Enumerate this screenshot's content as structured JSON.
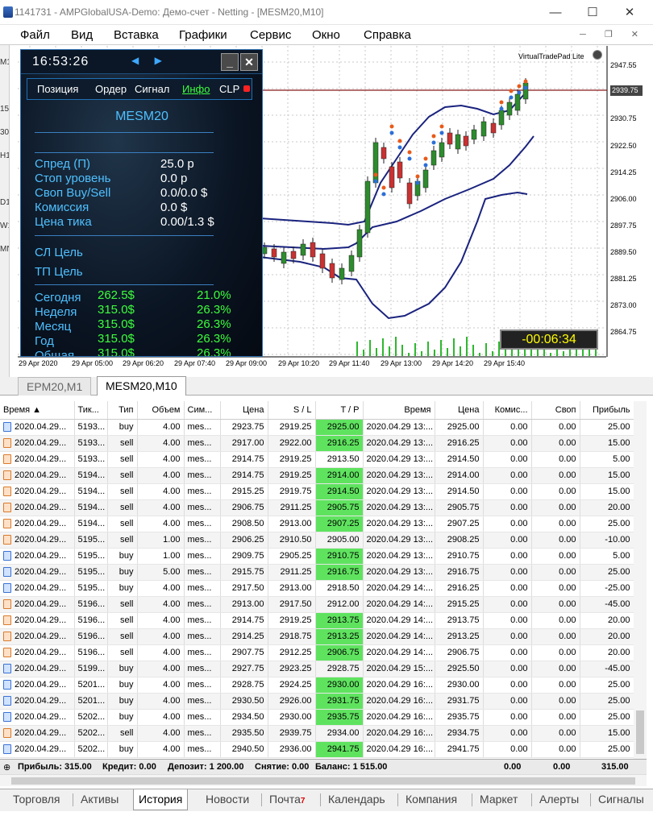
{
  "window": {
    "title": "1141731 - AMPGlobalUSA-Demo: Демо-счет - Netting - [MESM20,M10]",
    "min": "—",
    "max": "☐",
    "close": "✕"
  },
  "menu": [
    "Файл",
    "Вид",
    "Вставка",
    "Графики",
    "Сервис",
    "Окно",
    "Справка"
  ],
  "left_toolbar": [
    "M1",
    "15",
    "30",
    "H1",
    "D1",
    "W1",
    "MN"
  ],
  "chart": {
    "vtp_label": "VirtualTradePad  Lite",
    "timer": "-00:06:34",
    "current_price": "2939.75",
    "y_ticks": [
      "2947.55",
      "2939.75",
      "2930.75",
      "2922.50",
      "2914.25",
      "2906.00",
      "2897.75",
      "2889.50",
      "2881.25",
      "2873.00",
      "2864.75"
    ],
    "x_ticks": [
      "29 Apr 2020",
      "29 Apr 05:00",
      "29 Apr 06:20",
      "29 Apr 07:40",
      "29 Apr 09:00",
      "29 Apr 10:20",
      "29 Apr 11:40",
      "29 Apr 13:00",
      "29 Apr 14:20",
      "29 Apr 15:40"
    ]
  },
  "panel": {
    "time": "16:53:26",
    "arrows": "◀ ▶",
    "min_btn": "_",
    "close_btn": "✕",
    "tabs": [
      "Позиция",
      "Ордер",
      "Сигнал",
      "Инфо",
      "CLP"
    ],
    "symbol": "MESM20",
    "info": [
      {
        "label": "Спред (П)",
        "value": "25.0 p"
      },
      {
        "label": "Стоп уровень",
        "value": "0.0 p"
      },
      {
        "label": "Своп Buy/Sell",
        "value": "0.0/0.0 $"
      },
      {
        "label": "Комиссия",
        "value": "0.0 $"
      },
      {
        "label": "Цена тика",
        "value": "0.00/1.3 $"
      }
    ],
    "sl_target": "СЛ Цель",
    "tp_target": "ТП Цель",
    "stats": [
      {
        "label": "Сегодня",
        "amount": "262.5$",
        "pct": "21.0%"
      },
      {
        "label": "Неделя",
        "amount": "315.0$",
        "pct": "26.3%"
      },
      {
        "label": "Месяц",
        "amount": "315.0$",
        "pct": "26.3%"
      },
      {
        "label": "Год",
        "amount": "315.0$",
        "pct": "26.3%"
      },
      {
        "label": "Общая",
        "amount": "315.0$",
        "pct": "26.3%"
      }
    ]
  },
  "chart_tabs": [
    "EPM20,M1",
    "MESM20,M10"
  ],
  "columns": [
    "Время",
    "Тик...",
    "Тип",
    "Объем",
    "Сим...",
    "Цена",
    "S / L",
    "T / P",
    "Время",
    "Цена",
    "Комис...",
    "Своп",
    "Прибыль"
  ],
  "rows": [
    [
      "2020.04.29...",
      "5193...",
      "buy",
      "4.00",
      "mes...",
      "2923.75",
      "2919.25",
      "2925.00",
      "2020.04.29 13:...",
      "2925.00",
      "0.00",
      "0.00",
      "25.00"
    ],
    [
      "2020.04.29...",
      "5193...",
      "sell",
      "4.00",
      "mes...",
      "2917.00",
      "2922.00",
      "2916.25",
      "2020.04.29 13:...",
      "2916.25",
      "0.00",
      "0.00",
      "15.00"
    ],
    [
      "2020.04.29...",
      "5193...",
      "sell",
      "4.00",
      "mes...",
      "2914.75",
      "2919.25",
      "2913.50",
      "2020.04.29 13:...",
      "2914.50",
      "0.00",
      "0.00",
      "5.00"
    ],
    [
      "2020.04.29...",
      "5194...",
      "sell",
      "4.00",
      "mes...",
      "2914.75",
      "2919.25",
      "2914.00",
      "2020.04.29 13:...",
      "2914.00",
      "0.00",
      "0.00",
      "15.00"
    ],
    [
      "2020.04.29...",
      "5194...",
      "sell",
      "4.00",
      "mes...",
      "2915.25",
      "2919.75",
      "2914.50",
      "2020.04.29 13:...",
      "2914.50",
      "0.00",
      "0.00",
      "15.00"
    ],
    [
      "2020.04.29...",
      "5194...",
      "sell",
      "4.00",
      "mes...",
      "2906.75",
      "2911.25",
      "2905.75",
      "2020.04.29 13:...",
      "2905.75",
      "0.00",
      "0.00",
      "20.00"
    ],
    [
      "2020.04.29...",
      "5194...",
      "sell",
      "4.00",
      "mes...",
      "2908.50",
      "2913.00",
      "2907.25",
      "2020.04.29 13:...",
      "2907.25",
      "0.00",
      "0.00",
      "25.00"
    ],
    [
      "2020.04.29...",
      "5195...",
      "sell",
      "1.00",
      "mes...",
      "2906.25",
      "2910.50",
      "2905.00",
      "2020.04.29 13:...",
      "2908.25",
      "0.00",
      "0.00",
      "-10.00"
    ],
    [
      "2020.04.29...",
      "5195...",
      "buy",
      "1.00",
      "mes...",
      "2909.75",
      "2905.25",
      "2910.75",
      "2020.04.29 13:...",
      "2910.75",
      "0.00",
      "0.00",
      "5.00"
    ],
    [
      "2020.04.29...",
      "5195...",
      "buy",
      "5.00",
      "mes...",
      "2915.75",
      "2911.25",
      "2916.75",
      "2020.04.29 13:...",
      "2916.75",
      "0.00",
      "0.00",
      "25.00"
    ],
    [
      "2020.04.29...",
      "5195...",
      "buy",
      "4.00",
      "mes...",
      "2917.50",
      "2913.00",
      "2918.50",
      "2020.04.29 14:...",
      "2916.25",
      "0.00",
      "0.00",
      "-25.00"
    ],
    [
      "2020.04.29...",
      "5196...",
      "sell",
      "4.00",
      "mes...",
      "2913.00",
      "2917.50",
      "2912.00",
      "2020.04.29 14:...",
      "2915.25",
      "0.00",
      "0.00",
      "-45.00"
    ],
    [
      "2020.04.29...",
      "5196...",
      "sell",
      "4.00",
      "mes...",
      "2914.75",
      "2919.25",
      "2913.75",
      "2020.04.29 14:...",
      "2913.75",
      "0.00",
      "0.00",
      "20.00"
    ],
    [
      "2020.04.29...",
      "5196...",
      "sell",
      "4.00",
      "mes...",
      "2914.25",
      "2918.75",
      "2913.25",
      "2020.04.29 14:...",
      "2913.25",
      "0.00",
      "0.00",
      "20.00"
    ],
    [
      "2020.04.29...",
      "5196...",
      "sell",
      "4.00",
      "mes...",
      "2907.75",
      "2912.25",
      "2906.75",
      "2020.04.29 14:...",
      "2906.75",
      "0.00",
      "0.00",
      "20.00"
    ],
    [
      "2020.04.29...",
      "5199...",
      "buy",
      "4.00",
      "mes...",
      "2927.75",
      "2923.25",
      "2928.75",
      "2020.04.29 15:...",
      "2925.50",
      "0.00",
      "0.00",
      "-45.00"
    ],
    [
      "2020.04.29...",
      "5201...",
      "buy",
      "4.00",
      "mes...",
      "2928.75",
      "2924.25",
      "2930.00",
      "2020.04.29 16:...",
      "2930.00",
      "0.00",
      "0.00",
      "25.00"
    ],
    [
      "2020.04.29...",
      "5201...",
      "buy",
      "4.00",
      "mes...",
      "2930.50",
      "2926.00",
      "2931.75",
      "2020.04.29 16:...",
      "2931.75",
      "0.00",
      "0.00",
      "25.00"
    ],
    [
      "2020.04.29...",
      "5202...",
      "buy",
      "4.00",
      "mes...",
      "2934.50",
      "2930.00",
      "2935.75",
      "2020.04.29 16:...",
      "2935.75",
      "0.00",
      "0.00",
      "25.00"
    ],
    [
      "2020.04.29...",
      "5202...",
      "sell",
      "4.00",
      "mes...",
      "2935.50",
      "2939.75",
      "2934.00",
      "2020.04.29 16:...",
      "2934.75",
      "0.00",
      "0.00",
      "15.00"
    ],
    [
      "2020.04.29...",
      "5202...",
      "buy",
      "4.00",
      "mes...",
      "2940.50",
      "2936.00",
      "2941.75",
      "2020.04.29 16:...",
      "2941.75",
      "0.00",
      "0.00",
      "25.00"
    ]
  ],
  "tp_highlight_rows": [
    0,
    1,
    3,
    4,
    5,
    6,
    8,
    9,
    12,
    13,
    14,
    16,
    17,
    18,
    20
  ],
  "summary": {
    "profit": "Прибыль: 315.00",
    "credit": "Кредит: 0.00",
    "deposit": "Депозит: 1 200.00",
    "withdraw": "Снятие: 0.00",
    "balance": "Баланс: 1 515.00",
    "commission": "0.00",
    "swap": "0.00",
    "total": "315.00"
  },
  "bottom_tabs": [
    "Торговля",
    "Активы",
    "История",
    "Новости",
    "Почта",
    "Календарь",
    "Компания",
    "Маркет",
    "Алерты",
    "Сигналы"
  ],
  "mail_badge": "7",
  "colors": {
    "tp_highlight": "#5fe35f",
    "panel_accent": "#4fc0ff",
    "panel_green": "#3cff3c",
    "band": "#1a237e"
  }
}
